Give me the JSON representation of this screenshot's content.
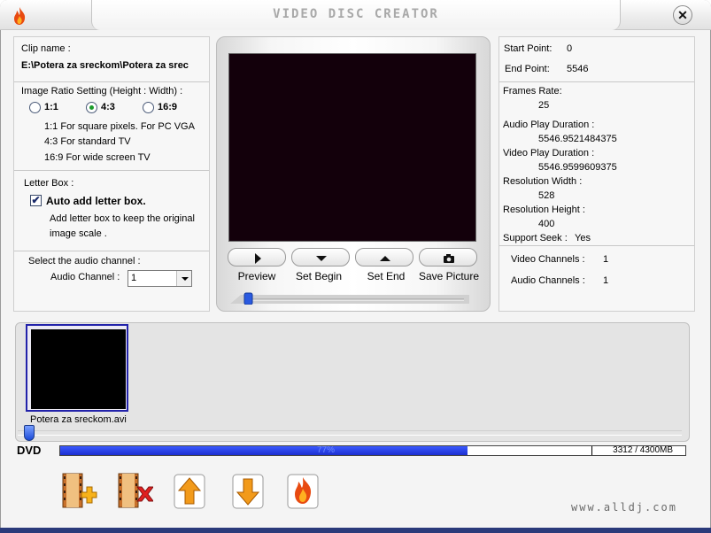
{
  "window": {
    "title": "VIDEO DISC CREATOR",
    "close_glyph": "✕",
    "app_icon": "flame-icon"
  },
  "clip": {
    "label": "Clip name :",
    "value": "E:\\Potera za sreckom\\Potera za srec"
  },
  "ratio": {
    "label": "Image Ratio Setting (Height : Width) :",
    "options": [
      "1:1",
      "4:3",
      "16:9"
    ],
    "selected": "4:3",
    "notes": [
      "1:1 For square pixels. For PC VGA",
      "4:3 For standard TV",
      "16:9 For wide screen TV"
    ]
  },
  "letterbox": {
    "label": "Letter Box :",
    "checkbox_label": "Auto add letter box.",
    "checked_glyph": "✔",
    "desc_line1": "Add letter box to keep the original",
    "desc_line2": "image scale ."
  },
  "audio": {
    "label": "Select the audio channel :",
    "channel_label": "Audio Channel :",
    "channel_value": "1"
  },
  "player": {
    "buttons": [
      {
        "label": "Preview",
        "icon": "play-icon"
      },
      {
        "label": "Set Begin",
        "icon": "triangle-down-icon"
      },
      {
        "label": "Set End",
        "icon": "triangle-up-icon"
      },
      {
        "label": "Save Picture",
        "icon": "camera-icon"
      }
    ],
    "seek_position": 0.0
  },
  "info": {
    "start_label": "Start Point:",
    "start_value": "0",
    "end_label": "End Point:",
    "end_value": "5546",
    "frames_label": "Frames Rate:",
    "frames_value": "25",
    "audio_dur_label": "Audio Play Duration :",
    "audio_dur_value": "5546.9521484375",
    "video_dur_label": "Video Play Duration :",
    "video_dur_value": "5546.9599609375",
    "res_w_label": "Resolution Width :",
    "res_w_value": "528",
    "res_h_label": "Resolution Height :",
    "res_h_value": "400",
    "seek_label": "Support Seek :",
    "seek_value": "Yes",
    "vch_label": "Video Channels :",
    "vch_value": "1",
    "ach_label": "Audio Channels :",
    "ach_value": "1"
  },
  "bin": {
    "clips": [
      {
        "name": "Potera za sreckom.avi"
      }
    ],
    "scroll_position": 0.0
  },
  "capacity": {
    "disc_label": "DVD",
    "percent_text": "77%",
    "fill_fraction": 0.77,
    "size_text": "3312 / 4300MB"
  },
  "toolbar": {
    "buttons": [
      {
        "name": "add-clip-button",
        "icon": "film-add-icon"
      },
      {
        "name": "remove-clip-button",
        "icon": "film-remove-icon"
      },
      {
        "name": "move-up-button",
        "icon": "arrow-up-icon"
      },
      {
        "name": "move-down-button",
        "icon": "arrow-down-icon"
      },
      {
        "name": "burn-button",
        "icon": "flame-icon"
      }
    ]
  },
  "watermark": "www.alldj.com",
  "colors": {
    "accent_blue": "#1c2fd0",
    "screen_bg": "#13000b",
    "thumb_border": "#2222aa"
  }
}
